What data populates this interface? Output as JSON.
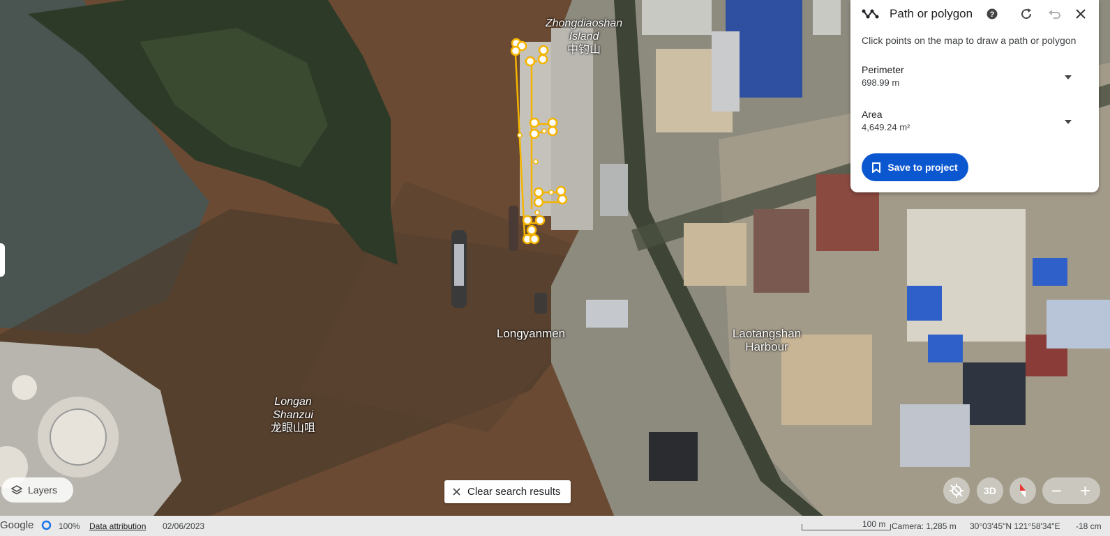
{
  "map": {
    "labels": {
      "zhongdiaoshan_en_1": "Zhongdiaoshan",
      "zhongdiaoshan_en_2": "Island",
      "zhongdiaoshan_zh": "中钓山",
      "longyanmen": "Longyanmen",
      "laotangshan_1": "Laotangshan",
      "laotangshan_2": "Harbour",
      "longan_1": "Longan",
      "longan_2": "Shanzui",
      "longan_zh": "龙眼山咀"
    }
  },
  "measure_panel": {
    "title": "Path or polygon",
    "hint": "Click points on the map to draw a path or polygon",
    "perimeter": {
      "label": "Perimeter",
      "value": "698.99 m"
    },
    "area": {
      "label": "Area",
      "value": "4,649.24 m²"
    },
    "save_label": "Save to project",
    "icons": [
      "path-polygon-icon",
      "help-icon",
      "refresh-icon",
      "undo-icon",
      "close-icon"
    ]
  },
  "controls": {
    "layers_label": "Layers",
    "clear_search_label": "Clear search results",
    "three_d_label": "3D",
    "zoom_out_label": "−",
    "zoom_in_label": "+"
  },
  "status_bar": {
    "logo": "Google",
    "load_percent": "100%",
    "data_attribution": "Data attribution",
    "date": "02/06/2023",
    "scale_label": "100 m",
    "camera": "Camera: 1,285 m",
    "coordinates": "30°03'45\"N 121°58'34\"E",
    "elevation": "-18 cm"
  },
  "colors": {
    "accent": "#0b57d0",
    "path": "#f5b400",
    "river": "#6a4a32"
  }
}
